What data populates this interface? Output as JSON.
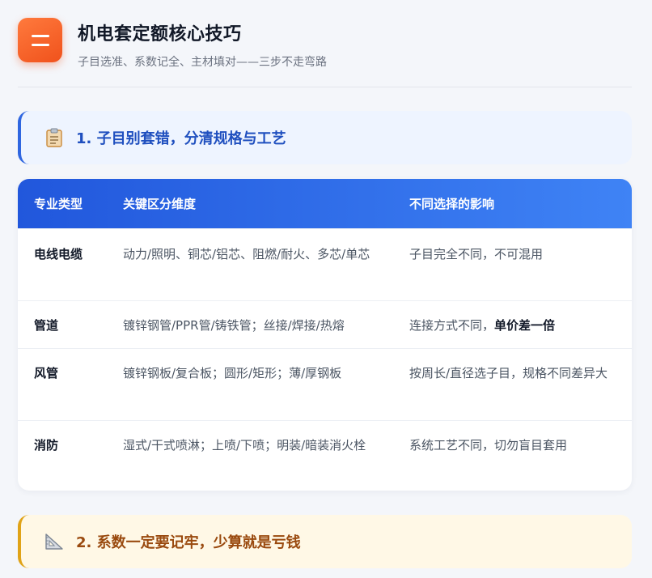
{
  "header": {
    "title": "机电套定额核心技巧",
    "subtitle": "子目选准、系数记全、主材填对——三步不走弯路"
  },
  "sections": [
    {
      "icon": "clipboard-icon",
      "title": "1. 子目别套错，分清规格与工艺"
    },
    {
      "icon": "triangle-ruler-icon",
      "title": "2. 系数一定要记牢，少算就是亏钱"
    }
  ],
  "table": {
    "headers": [
      "专业类型",
      "关键区分维度",
      "不同选择的影响"
    ],
    "rows": [
      {
        "type": "电线电缆",
        "dimension": "动力/照明、铜芯/铝芯、阻燃/耐火、多芯/单芯",
        "impact": "子目完全不同，不可混用",
        "impact_bold": ""
      },
      {
        "type": "管道",
        "dimension": "镀锌钢管/PPR管/铸铁管；丝接/焊接/热熔",
        "impact": "连接方式不同，",
        "impact_bold": "单价差一倍"
      },
      {
        "type": "风管",
        "dimension": "镀锌钢板/复合板；圆形/矩形；薄/厚钢板",
        "impact": "按周长/直径选子目，规格不同差异大",
        "impact_bold": ""
      },
      {
        "type": "消防",
        "dimension": "湿式/干式喷淋；上喷/下喷；明装/暗装消火栓",
        "impact": "系统工艺不同，切勿盲目套用",
        "impact_bold": ""
      }
    ]
  },
  "colors": {
    "accent_blue": "#2f66e0",
    "accent_orange": "#f0521c",
    "accent_yellow": "#e0a317"
  }
}
